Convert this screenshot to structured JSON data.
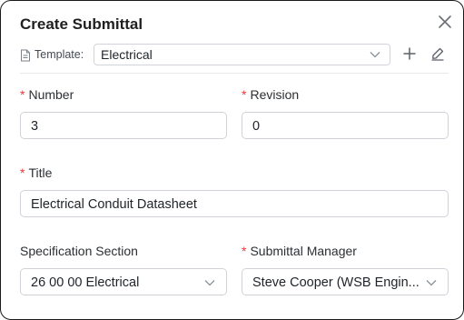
{
  "modal": {
    "title": "Create Submittal"
  },
  "template": {
    "label": "Template:",
    "value": "Electrical"
  },
  "fields": {
    "number": {
      "label": "Number",
      "required_mark": "*",
      "value": "3"
    },
    "revision": {
      "label": "Revision",
      "required_mark": "*",
      "value": "0"
    },
    "title": {
      "label": "Title",
      "required_mark": "*",
      "value": "Electrical Conduit Datasheet"
    },
    "spec_section": {
      "label": "Specification Section",
      "value": "26 00 00 Electrical"
    },
    "manager": {
      "label": "Submittal Manager",
      "required_mark": "*",
      "value": "Steve Cooper (WSB Engin..."
    }
  },
  "icons": {
    "close": "close-icon",
    "template": "document-icon",
    "add": "plus-icon",
    "edit": "pencil-icon",
    "dropdown": "chevron-down-icon"
  },
  "colors": {
    "required": "#e5383b",
    "border": "#cfd3d8"
  }
}
